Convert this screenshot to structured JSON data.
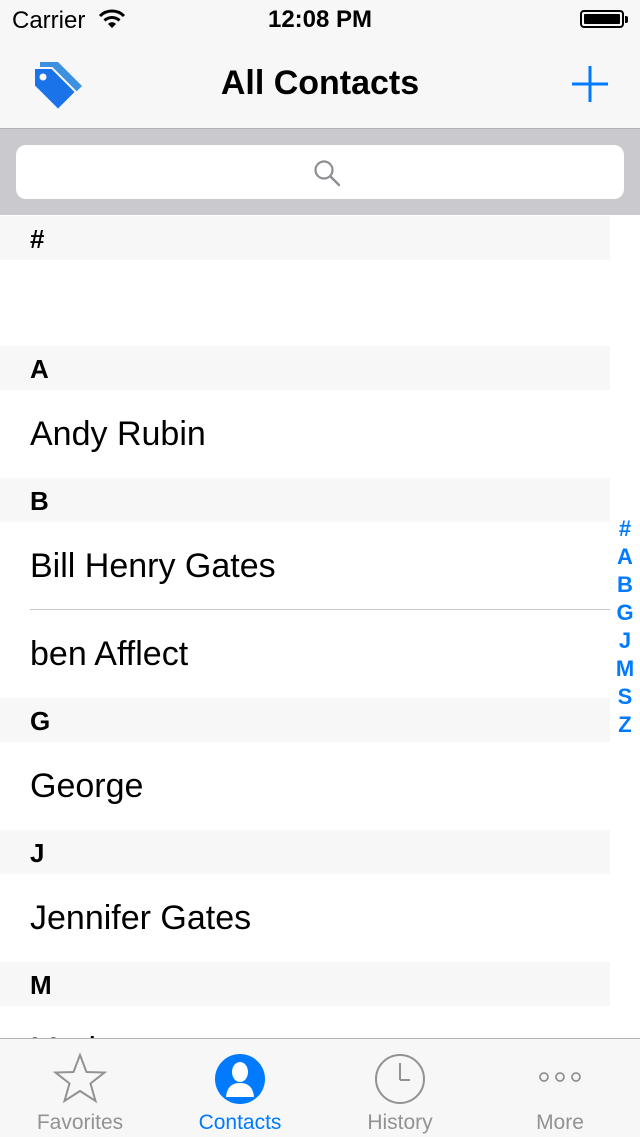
{
  "status_bar": {
    "carrier": "Carrier",
    "time": "12:08 PM"
  },
  "nav": {
    "title": "All Contacts"
  },
  "search": {
    "placeholder": ""
  },
  "sections": [
    {
      "letter": "#",
      "contacts": []
    },
    {
      "letter": "A",
      "contacts": [
        "Andy Rubin"
      ]
    },
    {
      "letter": "B",
      "contacts": [
        "Bill Henry Gates",
        "ben Afflect"
      ]
    },
    {
      "letter": "G",
      "contacts": [
        "George"
      ]
    },
    {
      "letter": "J",
      "contacts": [
        "Jennifer Gates"
      ]
    },
    {
      "letter": "M",
      "contacts": [
        "Mark"
      ]
    }
  ],
  "index": [
    "#",
    "A",
    "B",
    "G",
    "J",
    "M",
    "S",
    "Z"
  ],
  "tabs": [
    {
      "label": "Favorites",
      "icon": "star-icon",
      "active": false
    },
    {
      "label": "Contacts",
      "icon": "person-icon",
      "active": true
    },
    {
      "label": "History",
      "icon": "clock-icon",
      "active": false
    },
    {
      "label": "More",
      "icon": "ellipsis-icon",
      "active": false
    }
  ],
  "colors": {
    "accent": "#007aff",
    "inactive": "#929292",
    "section_bg": "#f7f7f7"
  }
}
